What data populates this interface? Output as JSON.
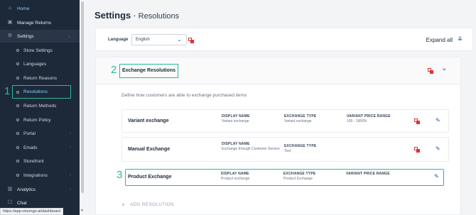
{
  "sidebar": {
    "items": [
      {
        "label": "Home",
        "icon": "home-icon"
      },
      {
        "label": "Manage Returns",
        "icon": "returns-icon"
      },
      {
        "label": "Settings",
        "icon": "gear-icon"
      },
      {
        "label": "Store Settings"
      },
      {
        "label": "Languages"
      },
      {
        "label": "Return Reasons"
      },
      {
        "label": "Resolutions"
      },
      {
        "label": "Return Methods"
      },
      {
        "label": "Return Policy"
      },
      {
        "label": "Portal"
      },
      {
        "label": "Emails"
      },
      {
        "label": "Storefront"
      },
      {
        "label": "Integrations"
      },
      {
        "label": "Analytics",
        "icon": "analytics-icon"
      },
      {
        "label": "Chat",
        "icon": "chat-icon"
      }
    ],
    "marker": "1"
  },
  "status_url": "https://app.returngo.ai/dashboard",
  "header": {
    "title": "Settings",
    "separator": "·",
    "subtitle": "Resolutions"
  },
  "language": {
    "label": "Language",
    "value": "English"
  },
  "expand_all": "Expand all",
  "section": {
    "marker": "2",
    "title": "Exchange Resolutions",
    "description": "Define how customers are able to exchange purchased items"
  },
  "columns": {
    "display_name": "DISPLAY NAME",
    "exchange_type": "EXCHANGE TYPE",
    "variant_price_range": "VARIANT PRICE RANGE"
  },
  "rows": [
    {
      "name": "Variant exchange",
      "display_name": "Variant exchange",
      "exchange_type": "Variant exchange",
      "price_range": "100 - 1000%"
    },
    {
      "name": "Manual Exchange",
      "display_name": "Exchange through Customer Service",
      "exchange_type": "Text"
    },
    {
      "name": "Product Exchange",
      "display_name": "Product exchange",
      "exchange_type": "Product Exchange"
    }
  ],
  "row_marker": "3",
  "add_resolution": "ADD RESOLUTION",
  "colors": {
    "sidebar_bg": "#1d2939",
    "highlight": "#26b99a",
    "accent": "#1f4fbf",
    "delete_red": "#e03131"
  }
}
